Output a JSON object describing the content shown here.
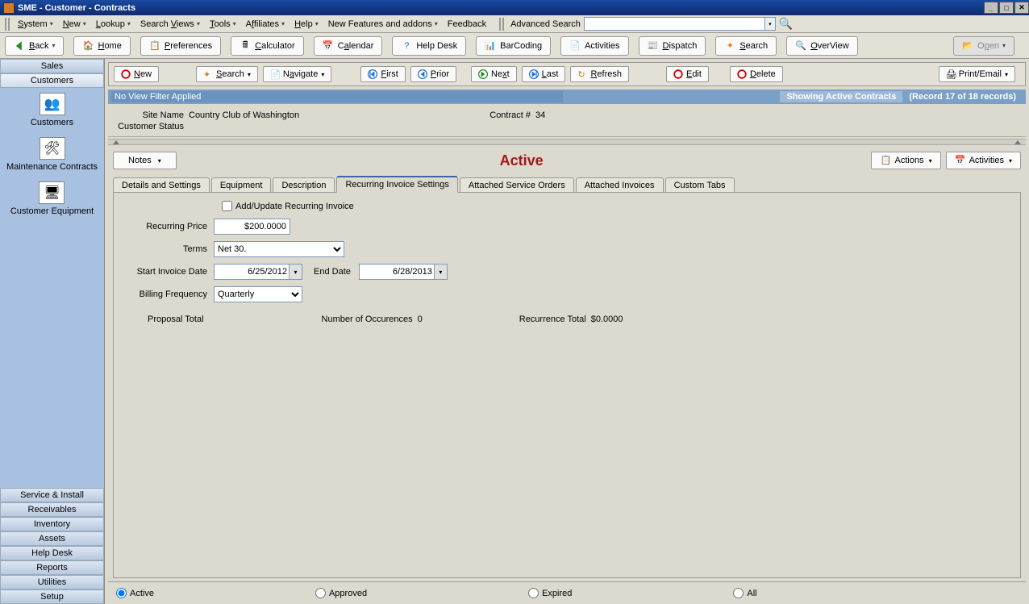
{
  "title": "SME - Customer - Contracts",
  "menu": {
    "system": "System",
    "new": "New",
    "lookup": "Lookup",
    "searchviews": "Search Views",
    "tools": "Tools",
    "affiliates": "Affiliates",
    "help": "Help",
    "newfeatures": "New Features and addons",
    "feedback": "Feedback",
    "advsearch": "Advanced Search"
  },
  "toolbar": {
    "back": "Back",
    "home": "Home",
    "preferences": "Preferences",
    "calculator": "Calculator",
    "calendar": "Calendar",
    "helpdesk": "Help Desk",
    "barcoding": "BarCoding",
    "activities": "Activities",
    "dispatch": "Dispatch",
    "search": "Search",
    "overview": "OverView",
    "open": "Open"
  },
  "sidebar": {
    "sales": "Sales",
    "customers": "Customers",
    "items": {
      "customers": "Customers",
      "maintenance": "Maintenance Contracts",
      "equipment": "Customer Equipment"
    },
    "bottom": {
      "service": "Service & Install",
      "receivables": "Receivables",
      "inventory": "Inventory",
      "assets": "Assets",
      "helpdesk": "Help Desk",
      "reports": "Reports",
      "utilities": "Utilities",
      "setup": "Setup"
    }
  },
  "nav": {
    "new": "New",
    "search": "Search",
    "navigate": "Navigate",
    "first": "First",
    "prior": "Prior",
    "next": "Next",
    "last": "Last",
    "refresh": "Refresh",
    "edit": "Edit",
    "delete": "Delete",
    "printemail": "Print/Email"
  },
  "filterbar": {
    "noview": "No View Filter Applied",
    "showing": "Showing Active Contracts",
    "record": "(Record 17 of 18 records)"
  },
  "info": {
    "sitename_label": "Site Name",
    "sitename": "Country Club of Washington",
    "custstatus_label": "Customer Status",
    "custstatus": "",
    "contractnum_label": "Contract #",
    "contractnum": "34"
  },
  "status": "Active",
  "buttons": {
    "notes": "Notes",
    "actions": "Actions",
    "activities": "Activities"
  },
  "tabs": {
    "details": "Details and Settings",
    "equipment": "Equipment",
    "description": "Description",
    "recurring": "Recurring Invoice Settings",
    "attachedorders": "Attached Service Orders",
    "attachedinv": "Attached Invoices",
    "custom": "Custom Tabs"
  },
  "form": {
    "addupdate": "Add/Update Recurring Invoice",
    "recurring_price_label": "Recurring Price",
    "recurring_price": "$200.0000",
    "terms_label": "Terms",
    "terms": "Net 30.",
    "start_label": "Start Invoice Date",
    "start": "6/25/2012",
    "end_label": "End Date",
    "end": "6/28/2013",
    "freq_label": "Billing Frequency",
    "freq": "Quarterly",
    "proposal_total_label": "Proposal Total",
    "proposal_total": "",
    "numoccur_label": "Number of Occurences",
    "numoccur": "0",
    "rectotal_label": "Recurrence Total",
    "rectotal": "$0.0000"
  },
  "radios": {
    "active": "Active",
    "approved": "Approved",
    "expired": "Expired",
    "all": "All"
  }
}
